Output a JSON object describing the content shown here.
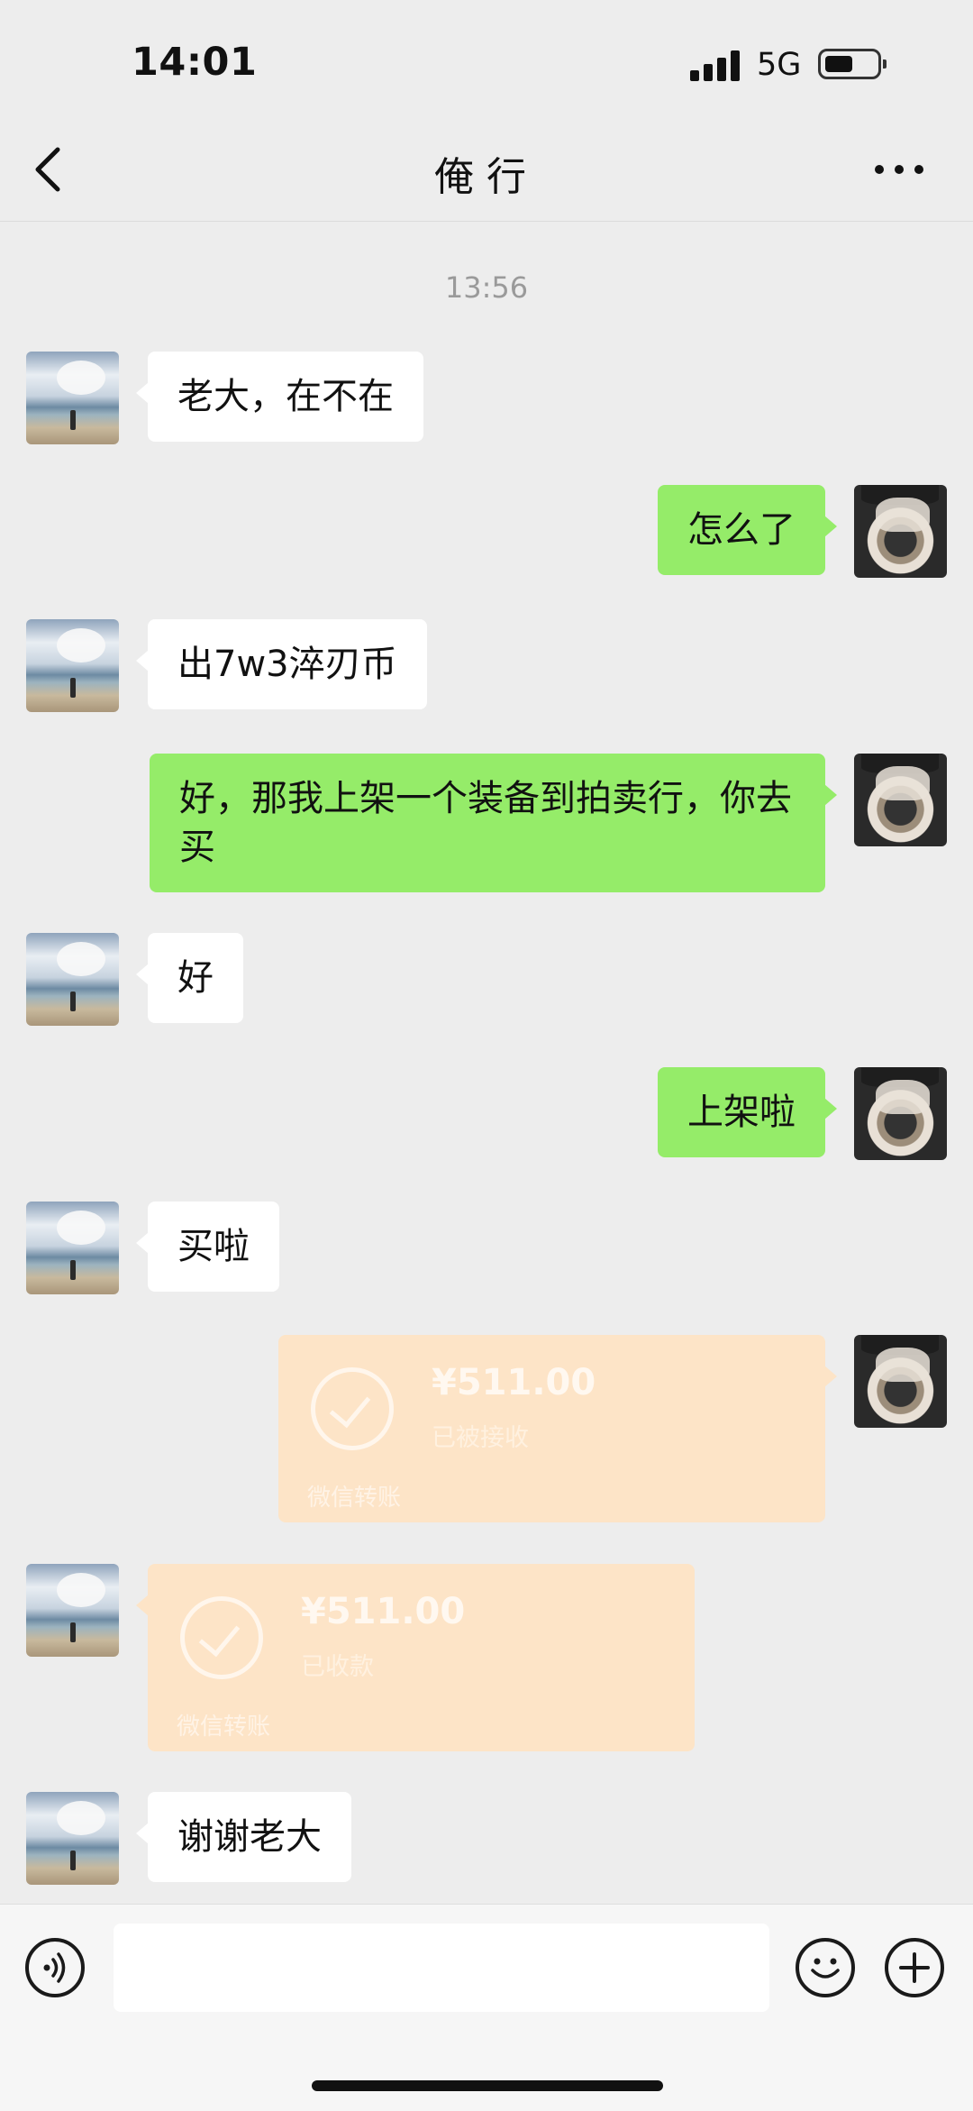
{
  "status_bar": {
    "time": "14:01",
    "network": "5G",
    "battery_level": 0.55
  },
  "header": {
    "title": "俺行",
    "back_icon": "chevron-left-icon",
    "more_icon": "more-dots-icon"
  },
  "chat": {
    "timestamp": "13:56",
    "messages": [
      {
        "side": "in",
        "text": "老大，在不在"
      },
      {
        "side": "out",
        "text": "怎么了"
      },
      {
        "side": "in",
        "text": "出7w3淬刃币"
      },
      {
        "side": "out",
        "text": "好，那我上架一个装备到拍卖行，你去买"
      },
      {
        "side": "in",
        "text": "好"
      },
      {
        "side": "out",
        "text": "上架啦"
      },
      {
        "side": "in",
        "text": "买啦"
      },
      {
        "side": "out",
        "type": "transfer",
        "amount": "¥511.00",
        "status": "已被接收",
        "brand": "微信转账"
      },
      {
        "side": "in",
        "type": "transfer",
        "amount": "¥511.00",
        "status": "已收款",
        "brand": "微信转账"
      },
      {
        "side": "in",
        "text": "谢谢老大"
      }
    ]
  },
  "input_bar": {
    "voice_icon": "voice-icon",
    "placeholder": "",
    "emoji_icon": "emoji-icon",
    "plus_icon": "plus-icon"
  },
  "colors": {
    "background": "#ededed",
    "outgoing_bubble": "#95ec69",
    "incoming_bubble": "#ffffff",
    "transfer_card": "#fde4c7"
  }
}
